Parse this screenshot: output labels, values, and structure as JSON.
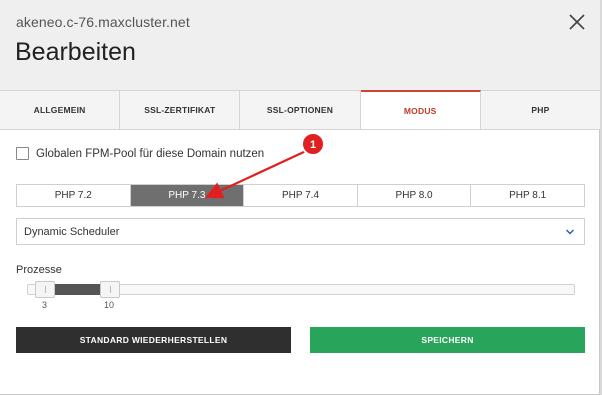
{
  "header": {
    "subtitle": "akeneo.c-76.maxcluster.net",
    "title": "Bearbeiten"
  },
  "tabs": [
    {
      "label": "ALLGEMEIN",
      "active": false
    },
    {
      "label": "SSL-ZERTIFIKAT",
      "active": false
    },
    {
      "label": "SSL-OPTIONEN",
      "active": false
    },
    {
      "label": "MODUS",
      "active": true
    },
    {
      "label": "PHP",
      "active": false
    }
  ],
  "fpm_checkbox": {
    "label": "Globalen FPM-Pool für diese Domain nutzen",
    "checked": false
  },
  "php_versions": {
    "options": [
      "PHP 7.2",
      "PHP 7.3",
      "PHP 7.4",
      "PHP 8.0",
      "PHP 8.1"
    ],
    "selected": "PHP 7.3"
  },
  "scheduler_select": {
    "value": "Dynamic Scheduler"
  },
  "prozesse": {
    "label": "Prozesse",
    "min_value": "3",
    "max_value": "10"
  },
  "buttons": {
    "reset_label": "STANDARD WIEDERHERSTELLEN",
    "save_label": "SPEICHERN"
  },
  "annotation": {
    "number": "1",
    "color": "#e02020"
  },
  "colors": {
    "active_tab": "#c0392b",
    "save_button": "#28a55a",
    "reset_button": "#2f2f2f",
    "selected_segment": "#6f6f6f"
  },
  "icons": {
    "close": "close-icon",
    "select": "chevron-down-icon"
  }
}
